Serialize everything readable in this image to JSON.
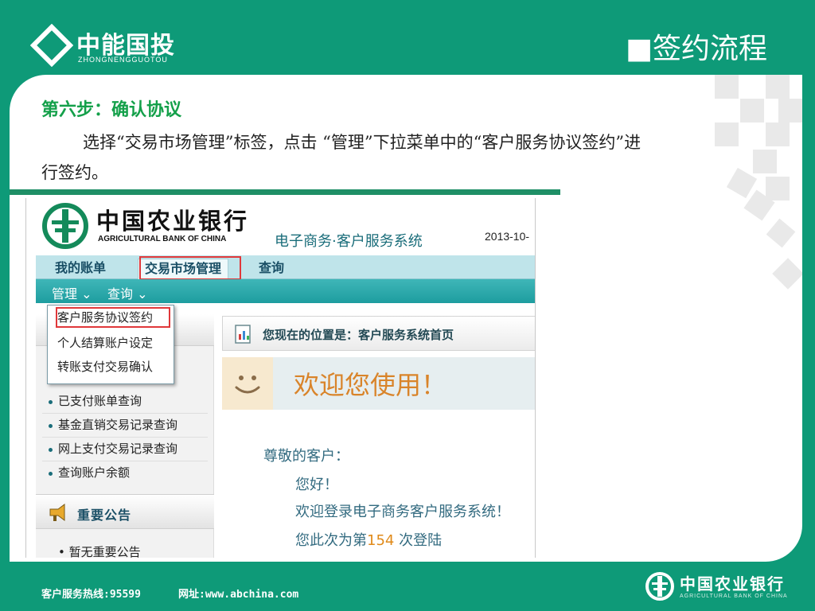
{
  "slide": {
    "company_cn": "中能国投",
    "company_en": "ZHONGNENGGUOTOU",
    "section_title": "■签约流程",
    "step_title": "第六步：确认协议",
    "step_desc": "选择“交易市场管理”标签，点击 “管理”下拉菜单中的“客户服务协议签约”进行签约。"
  },
  "screenshot": {
    "bank_cn": "中国农业银行",
    "bank_en": "AGRICULTURAL BANK OF CHINA",
    "system_name": "电子商务·客户服务系统",
    "date": "2013-10-",
    "tabs": [
      "我的账单",
      "交易市场管理",
      "查询"
    ],
    "submenus": [
      "管理 ⌄",
      "查询 ⌄"
    ],
    "dropdown": [
      "客户服务协议签约",
      "个人结算账户设定",
      "转账支付交易确认"
    ],
    "sidebar_items": [
      "已支付账单查询",
      "基金直销交易记录查询",
      "网上支付交易记录查询",
      "查询账户余额"
    ],
    "notice_title": "重要公告",
    "notice_item": "• 暂无重要公告",
    "location": "您现在的位置是：客户服务系统首页",
    "welcome": "欢迎您使用！",
    "greeting": "尊敬的客户：",
    "hello": "您好！",
    "welcome_line": "欢迎登录电子商务客户服务系统！",
    "visit_prefix": "您此次为第",
    "visit_count": "154",
    "visit_suffix": "次登陆"
  },
  "footer": {
    "hotline": "客户服务热线:95599",
    "website": "网址:www.abchina.com",
    "logo_cn": "中国农业银行",
    "logo_en": "AGRICULTURAL BANK OF CHINA"
  },
  "colors": {
    "brand_green": "#0e9a78",
    "step_green": "#14a04a",
    "highlight_red": "#e0383a"
  }
}
